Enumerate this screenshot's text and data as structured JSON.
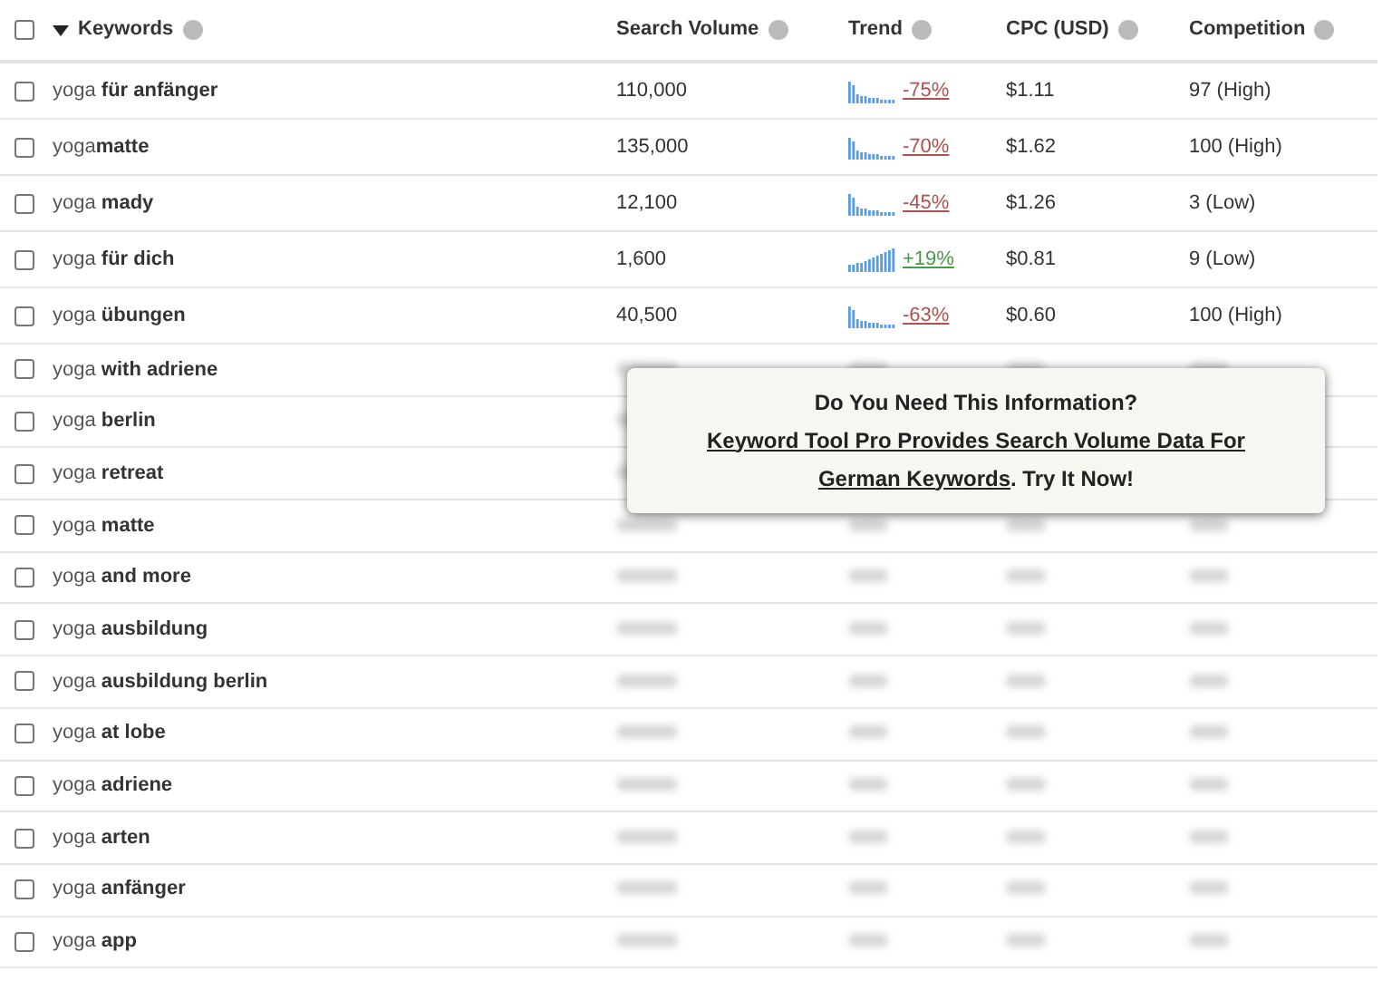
{
  "header": {
    "select_all_checked": false,
    "columns": [
      "Keywords",
      "Search Volume",
      "Trend",
      "CPC (USD)",
      "Competition"
    ]
  },
  "rows": [
    {
      "kind": "data",
      "checked": false,
      "keyword": "yoga **für anfänger**",
      "volume": "110,000",
      "trend": {
        "text": "-75%",
        "kind": "down"
      },
      "cpc": "$1.11",
      "competition": "97 (High)"
    },
    {
      "kind": "data",
      "checked": false,
      "keyword": "yoga**matte**",
      "volume": "135,000",
      "trend": {
        "text": "-70%",
        "kind": "down"
      },
      "cpc": "$1.62",
      "competition": "100 (High)"
    },
    {
      "kind": "data",
      "checked": false,
      "keyword": "yoga **mady**",
      "volume": "12,100",
      "trend": {
        "text": "-45%",
        "kind": "down"
      },
      "cpc": "$1.26",
      "competition": "3 (Low)"
    },
    {
      "kind": "data",
      "checked": false,
      "keyword": "yoga **für dich**",
      "volume": "1,600",
      "trend": {
        "text": "+19%",
        "kind": "up"
      },
      "cpc": "$0.81",
      "competition": "9 (Low)"
    },
    {
      "kind": "data",
      "checked": false,
      "keyword": "yoga **übungen**",
      "volume": "40,500",
      "trend": {
        "text": "-63%",
        "kind": "down"
      },
      "cpc": "$0.60",
      "competition": "100 (High)"
    },
    {
      "kind": "locked",
      "checked": false,
      "keyword": "yoga **with adriene**"
    },
    {
      "kind": "covered",
      "checked": false,
      "keyword": "yoga **berlin**"
    },
    {
      "kind": "covered",
      "checked": false,
      "keyword": "yoga **retreat**"
    },
    {
      "kind": "locked",
      "checked": false,
      "keyword": "yoga **matte**"
    },
    {
      "kind": "locked",
      "checked": false,
      "keyword": "yoga **and more**"
    },
    {
      "kind": "locked",
      "checked": false,
      "keyword": "yoga **ausbildung**"
    },
    {
      "kind": "locked",
      "checked": false,
      "keyword": "yoga **ausbildung berlin**"
    },
    {
      "kind": "locked",
      "checked": false,
      "keyword": "yoga **at lobe**"
    },
    {
      "kind": "locked",
      "checked": false,
      "keyword": "yoga **adriene**"
    },
    {
      "kind": "locked",
      "checked": false,
      "keyword": "yoga **arten**"
    },
    {
      "kind": "locked",
      "checked": false,
      "keyword": "yoga **anfänger**"
    },
    {
      "kind": "locked",
      "checked": false,
      "keyword": "yoga **app**"
    }
  ],
  "popup": {
    "title": "Do You Need This Information?",
    "link_lines": [
      "Keyword Tool Pro Provides Search Volume Data For",
      "German Keywords"
    ],
    "suffix": ". Try It Now!"
  }
}
